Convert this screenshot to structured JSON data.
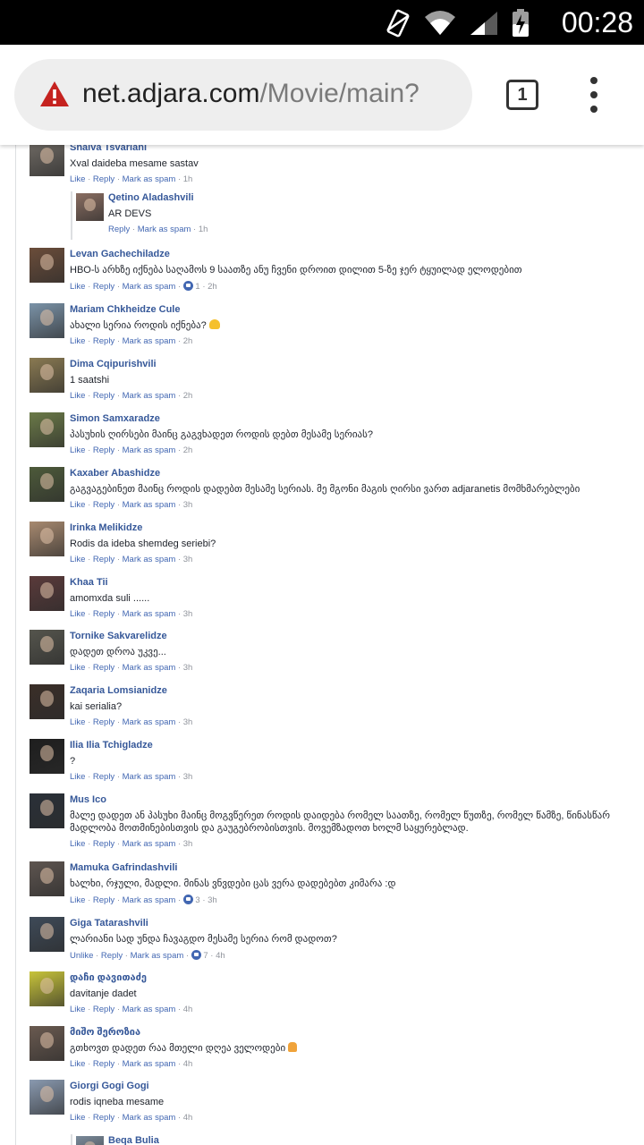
{
  "status_bar": {
    "time": "00:28"
  },
  "browser": {
    "url_host": "net.adjara.com",
    "url_path": "/Movie/main?",
    "tab_count": "1"
  },
  "comments": [
    {
      "name": "Shalva Tsvariani",
      "text": "Xval daideba mesame sastav",
      "actions": [
        "Like",
        "Reply",
        "Mark as spam"
      ],
      "time": "1h",
      "avatar_color": "#6f6a64"
    },
    {
      "name": "Qetino Aladashvili",
      "text": "AR DEVS",
      "actions": [
        "Reply",
        "Mark as spam"
      ],
      "time": "1h",
      "reply": true,
      "avatar_color": "#8a6e62"
    },
    {
      "name": "Levan Gachechiladze",
      "text": "HBO-ს არხზე იქნება საღამოს 9 საათზე ანუ ჩვენი დროით დილით 5-ზე ჯერ ტყუილად ელოდებით",
      "actions": [
        "Like",
        "Reply",
        "Mark as spam"
      ],
      "likes": "1",
      "time": "2h",
      "avatar_color": "#6b4d3a"
    },
    {
      "name": "Mariam Chkheidze Cule",
      "text": "ახალი სერია როდის იქნება?",
      "emoji": "heart",
      "actions": [
        "Like",
        "Reply",
        "Mark as spam"
      ],
      "time": "2h",
      "avatar_color": "#7b93a8"
    },
    {
      "name": "Dima Cqipurishvili",
      "text": "1 saatshi",
      "actions": [
        "Like",
        "Reply",
        "Mark as spam"
      ],
      "time": "2h",
      "avatar_color": "#8a7a52"
    },
    {
      "name": "Simon Samxaradze",
      "text": "პასუხის ღირსები მაინც გაგვხადეთ როდის დებთ მესამე სერიას?",
      "actions": [
        "Like",
        "Reply",
        "Mark as spam"
      ],
      "time": "2h",
      "avatar_color": "#6b7a48"
    },
    {
      "name": "Kaxaber Abashidze",
      "text": "გაგვაგებინეთ მაინც როდის დადებთ მესამე სერიას. მე მგონი მაგის ღირსი ვართ adjaranetis მომხმარებლები",
      "actions": [
        "Like",
        "Reply",
        "Mark as spam"
      ],
      "time": "3h",
      "avatar_color": "#4d5a3a"
    },
    {
      "name": "Irinka Melikidze",
      "text": "Rodis da ideba shemdeg seriebi?",
      "actions": [
        "Like",
        "Reply",
        "Mark as spam"
      ],
      "time": "3h",
      "avatar_color": "#a88a70"
    },
    {
      "name": "Khaa Tii",
      "text": "amomxda suli ......",
      "actions": [
        "Like",
        "Reply",
        "Mark as spam"
      ],
      "time": "3h",
      "avatar_color": "#5a3a3a"
    },
    {
      "name": "Tornike Sakvarelidze",
      "text": "დადეთ დროა უკვე...",
      "actions": [
        "Like",
        "Reply",
        "Mark as spam"
      ],
      "time": "3h",
      "avatar_color": "#55554d"
    },
    {
      "name": "Zaqaria Lomsianidze",
      "text": "kai serialia?",
      "actions": [
        "Like",
        "Reply",
        "Mark as spam"
      ],
      "time": "3h",
      "avatar_color": "#3a2e28"
    },
    {
      "name": "Ilia Ilia Tchigladze",
      "text": "?",
      "actions": [
        "Like",
        "Reply",
        "Mark as spam"
      ],
      "time": "3h",
      "avatar_color": "#1e1e1e"
    },
    {
      "name": "Mus Ico",
      "text": "მალე დადეთ ან პასუხი მაინც მოგვწერეთ როდის დაიდება რომელ საათზე, რომელ წუთზე, რომელ წამზე, წინასწარ მადლობა მოთმინებისთვის და გაუგებრობისთვის. მოვემზადოთ ხოლმ საყურებლად.",
      "wrap": true,
      "actions": [
        "Like",
        "Reply",
        "Mark as spam"
      ],
      "time": "3h",
      "avatar_color": "#2a3038"
    },
    {
      "name": "Mamuka Gafrindashvili",
      "text": "ხალხი, რჯული, მადლი. მინას ვნვდები ცას ვერა დადებებთ კიმარა :დ",
      "actions": [
        "Like",
        "Reply",
        "Mark as spam"
      ],
      "likes": "3",
      "time": "3h",
      "avatar_color": "#5e5550"
    },
    {
      "name": "Giga Tatarashvili",
      "text": "ლარიანი სად უნდა ჩავაგდო მესამე სერია რომ დადოთ?",
      "actions": [
        "Unlike",
        "Reply",
        "Mark as spam"
      ],
      "likes": "7",
      "time": "4h",
      "avatar_color": "#3e4a58"
    },
    {
      "name": "დაჩი დავითაძე",
      "text": "davitanje dadet",
      "actions": [
        "Like",
        "Reply",
        "Mark as spam"
      ],
      "time": "4h",
      "avatar_color": "#c8c43a"
    },
    {
      "name": "მიშო შეროზია",
      "text": "გთხოვთ დადეთ რაა მთელი დღეა ველოდები",
      "emoji": "pray",
      "actions": [
        "Like",
        "Reply",
        "Mark as spam"
      ],
      "time": "4h",
      "avatar_color": "#6a5a50"
    },
    {
      "name": "Giorgi Gogi Gogi",
      "text": "rodis iqneba mesame",
      "actions": [
        "Like",
        "Reply",
        "Mark as spam"
      ],
      "time": "4h",
      "avatar_color": "#8a9ab0"
    },
    {
      "name": "Beqa Bulia",
      "text": "",
      "actions": [],
      "time": "",
      "reply": true,
      "avatar_color": "#7a8a9a"
    }
  ]
}
